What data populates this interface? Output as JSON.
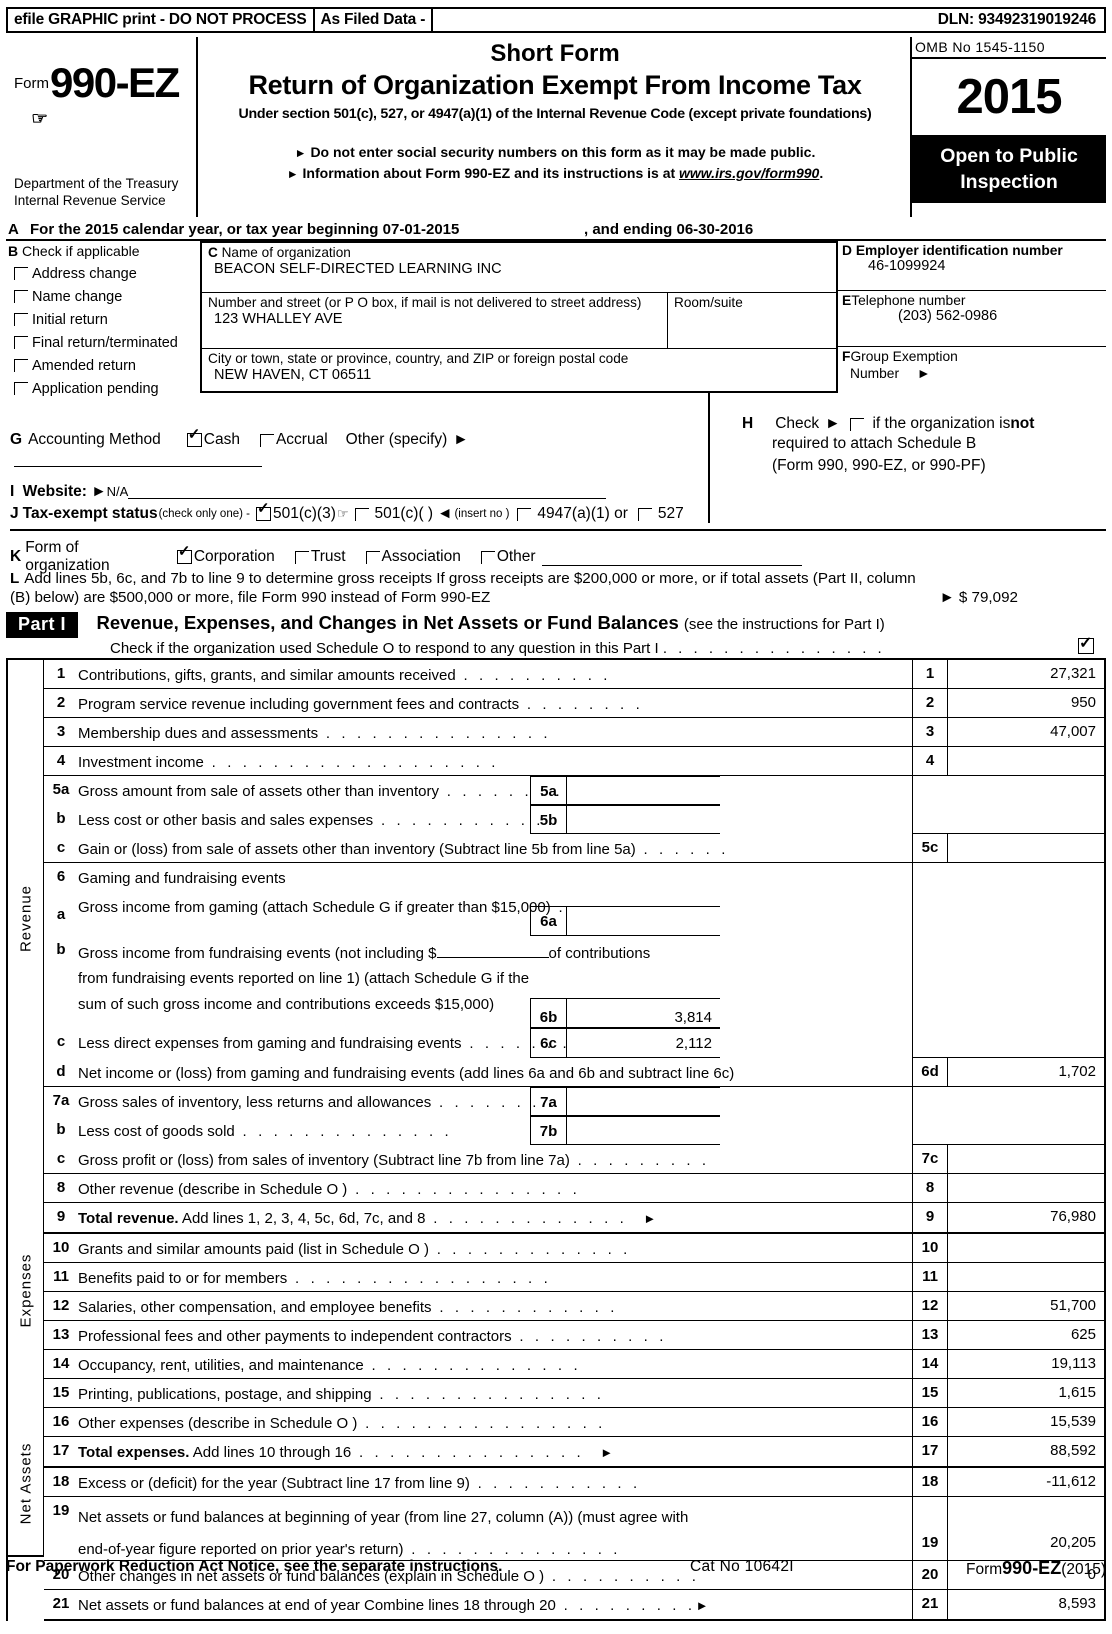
{
  "efile": {
    "graphic_print": "efile GRAPHIC print - DO NOT PROCESS",
    "as_filed": "As Filed Data -",
    "dln": "DLN: 93492319019246"
  },
  "masthead": {
    "form_label": "Form",
    "form_number": "990-EZ",
    "department": "Department of the Treasury",
    "service": "Internal Revenue Service",
    "short_form": "Short Form",
    "title": "Return of Organization Exempt From Income Tax",
    "subtitle": "Under section 501(c), 527, or 4947(a)(1) of the Internal Revenue Code (except private foundations)",
    "bullet1": "Do not enter social security numbers on this form as it may be made public.",
    "bullet2_pre": "Information about Form 990-EZ and its instructions is at ",
    "bullet2_link": "www.irs.gov/form990",
    "bullet2_post": ".",
    "omb": "OMB No 1545-1150",
    "year": "2015",
    "open_line1": "Open to Public",
    "open_line2": "Inspection"
  },
  "line_a": {
    "letter": "A",
    "text": "For the 2015 calendar year, or tax year beginning 07-01-2015",
    "ending": ", and ending 06-30-2016"
  },
  "section_b": {
    "letter": "B",
    "heading": "Check if applicable",
    "items": [
      {
        "label": "Address change",
        "checked": false
      },
      {
        "label": "Name change",
        "checked": false
      },
      {
        "label": "Initial return",
        "checked": false
      },
      {
        "label": "Final return/terminated",
        "checked": false
      },
      {
        "label": "Amended return",
        "checked": false
      },
      {
        "label": "Application pending",
        "checked": false
      }
    ]
  },
  "section_c": {
    "letter": "C",
    "name_label": "Name of organization",
    "name_value": "BEACON SELF-DIRECTED LEARNING INC",
    "street_label": "Number and street (or P  O  box, if mail is not delivered to street address)",
    "street_value": "123 WHALLEY AVE",
    "room_label": "Room/suite",
    "room_value": "",
    "city_label": "City or town, state or province, country, and ZIP or foreign postal code",
    "city_value": "NEW HAVEN, CT  06511"
  },
  "section_d": {
    "letter": "D",
    "ein_label": "Employer identification number",
    "ein_value": "46-1099924",
    "tel_letter": "E",
    "tel_label": "Telephone number",
    "tel_value": "(203) 562-0986",
    "grp_letter": "F",
    "grp_label_1": "Group Exemption",
    "grp_label_2": "Number",
    "grp_value": ""
  },
  "section_g": {
    "letter": "G",
    "label": "Accounting Method",
    "cash": "Cash",
    "cash_checked": true,
    "accrual": "Accrual",
    "accrual_checked": false,
    "other": "Other (specify)"
  },
  "section_h": {
    "letter": "H",
    "check_label": "Check",
    "text_1": "if the organization is ",
    "text_not": "not",
    "text_2": "required to attach Schedule B",
    "text_3": "(Form 990, 990-EZ, or 990-PF)",
    "checked": false
  },
  "section_i": {
    "letter": "I",
    "label": "Website:",
    "value": "N/A"
  },
  "section_j": {
    "letter": "J",
    "label": "Tax-exempt status",
    "note": "(check only one) -",
    "opt1": "501(c)(3)",
    "opt1_checked": true,
    "opt2": "501(c)(  )",
    "opt2_checked": false,
    "insert_no": "(insert no )",
    "opt3": "4947(a)(1) or",
    "opt3_checked": false,
    "opt4": "527",
    "opt4_checked": false
  },
  "section_k": {
    "letter": "K",
    "label": "Form of organization",
    "opt1": "Corporation",
    "opt1_checked": true,
    "opt2": "Trust",
    "opt2_checked": false,
    "opt3": "Association",
    "opt3_checked": false,
    "opt4": "Other",
    "opt4_checked": false
  },
  "section_l": {
    "letter": "L",
    "text_line1": "Add lines 5b, 6c, and 7b to line 9 to determine gross receipts  If gross receipts are $200,000 or more, or if total assets (Part II, column",
    "text_line2": "(B) below) are $500,000 or more, file Form 990 instead of Form 990-EZ",
    "amount": "$ 79,092"
  },
  "part1": {
    "chip": "Part I",
    "title": "Revenue, Expenses, and Changes in Net Assets or Fund Balances",
    "title_note": "(see the instructions for Part I)",
    "check_text": "Check if the organization used Schedule O to respond to any question in this Part I",
    "checked": true,
    "revenue_label": "Revenue",
    "expenses_label": "Expenses",
    "netassets_label": "Net Assets"
  },
  "rows": {
    "r1": {
      "num": "1",
      "desc": "Contributions, gifts, grants, and similar amounts received",
      "code": "1",
      "value": "27,321"
    },
    "r2": {
      "num": "2",
      "desc": "Program service revenue including government fees and contracts",
      "code": "2",
      "value": "950"
    },
    "r3": {
      "num": "3",
      "desc": "Membership dues and assessments",
      "code": "3",
      "value": "47,007"
    },
    "r4": {
      "num": "4",
      "desc": "Investment income",
      "code": "4",
      "value": ""
    },
    "r5a": {
      "num": "5a",
      "desc": "Gross amount from sale of assets other than inventory",
      "code": "5a",
      "value": ""
    },
    "r5b": {
      "num": "b",
      "desc": "Less  cost or other basis and sales expenses",
      "code": "5b",
      "value": ""
    },
    "r5c": {
      "num": "c",
      "desc": "Gain or (loss) from sale of assets other than inventory (Subtract line 5b from line 5a)",
      "code": "5c",
      "value": ""
    },
    "r6": {
      "num": "6",
      "desc": "Gaming and fundraising events"
    },
    "r6a": {
      "num": "a",
      "desc": "Gross income from gaming (attach Schedule G if greater than $15,000)",
      "code": "6a",
      "value": ""
    },
    "r6b": {
      "num": "b",
      "desc_line1_pre": "Gross income from fundraising events (not including $",
      "desc_line1_post": "of contributions",
      "desc_line2": "from fundraising events reported on line 1) (attach Schedule G if the",
      "desc_line3": "sum of such gross income and contributions exceeds $15,000)",
      "code": "6b",
      "value": "3,814"
    },
    "r6c": {
      "num": "c",
      "desc": "Less  direct expenses from gaming and fundraising events",
      "code": "6c",
      "value": "2,112"
    },
    "r6d": {
      "num": "d",
      "desc": "Net income or (loss) from gaming and fundraising events (add lines 6a and 6b and subtract line 6c)",
      "code": "6d",
      "value": "1,702"
    },
    "r7a": {
      "num": "7a",
      "desc": "Gross sales of inventory, less returns and allowances",
      "code": "7a",
      "value": ""
    },
    "r7b": {
      "num": "b",
      "desc": "Less  cost of goods sold",
      "code": "7b",
      "value": ""
    },
    "r7c": {
      "num": "c",
      "desc": "Gross profit or (loss) from sales of inventory (Subtract line 7b from line 7a)",
      "code": "7c",
      "value": ""
    },
    "r8": {
      "num": "8",
      "desc": "Other revenue (describe in Schedule O )",
      "code": "8",
      "value": ""
    },
    "r9": {
      "num": "9",
      "desc_bold": "Total revenue.",
      "desc": " Add lines 1, 2, 3, 4, 5c, 6d, 7c, and 8",
      "code": "9",
      "value": "76,980"
    },
    "r10": {
      "num": "10",
      "desc": "Grants and similar amounts paid (list in Schedule O )",
      "code": "10",
      "value": ""
    },
    "r11": {
      "num": "11",
      "desc": "Benefits paid to or for members",
      "code": "11",
      "value": ""
    },
    "r12": {
      "num": "12",
      "desc": "Salaries, other compensation, and employee benefits",
      "code": "12",
      "value": "51,700"
    },
    "r13": {
      "num": "13",
      "desc": "Professional fees and other payments to independent contractors",
      "code": "13",
      "value": "625"
    },
    "r14": {
      "num": "14",
      "desc": "Occupancy, rent, utilities, and maintenance",
      "code": "14",
      "value": "19,113"
    },
    "r15": {
      "num": "15",
      "desc": "Printing, publications, postage, and shipping",
      "code": "15",
      "value": "1,615"
    },
    "r16": {
      "num": "16",
      "desc": "Other expenses (describe in Schedule O )",
      "code": "16",
      "value": "15,539"
    },
    "r17": {
      "num": "17",
      "desc_bold": "Total expenses.",
      "desc": " Add lines 10 through 16",
      "code": "17",
      "value": "88,592"
    },
    "r18": {
      "num": "18",
      "desc": "Excess or (deficit) for the year (Subtract line 17 from line 9)",
      "code": "18",
      "value": "-11,612"
    },
    "r19": {
      "num": "19",
      "desc_line1": "Net assets or fund balances at beginning of year (from line 27, column (A)) (must agree with",
      "desc_line2": "end-of-year figure reported on prior year's return)",
      "code": "19",
      "value": "20,205"
    },
    "r20": {
      "num": "20",
      "desc": "Other changes in net assets or fund balances (explain in Schedule O )",
      "code": "20",
      "value": "0"
    },
    "r21": {
      "num": "21",
      "desc": "Net assets or fund balances at end of year  Combine lines 18 through 20",
      "code": "21",
      "value": "8,593"
    }
  },
  "footer": {
    "left": "For Paperwork Reduction Act Notice, see the separate instructions.",
    "center": "Cat No 10642I",
    "right_pre": "Form",
    "right_bold": "990-EZ",
    "right_post": "(2015)"
  }
}
